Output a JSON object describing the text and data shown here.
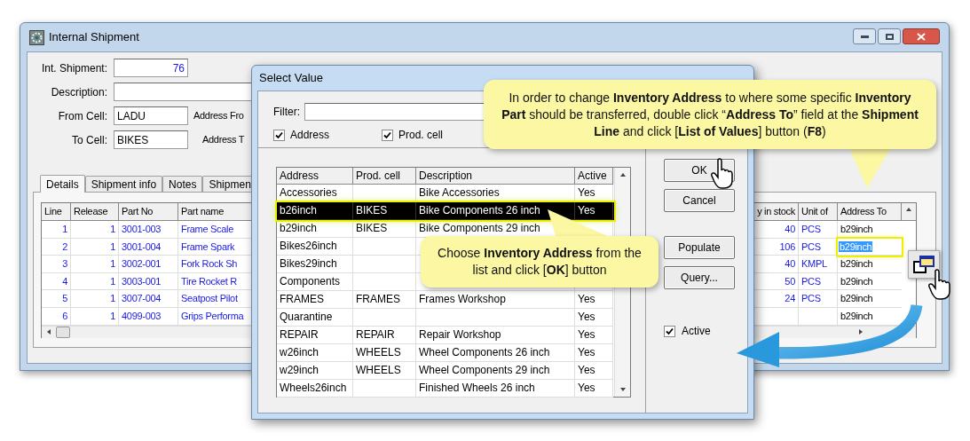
{
  "window": {
    "title": "Internal Shipment"
  },
  "form": {
    "fields": [
      {
        "label": "Int. Shipment:",
        "value": "76"
      },
      {
        "label": "Description:"
      },
      {
        "label": "From Cell:",
        "value": "LADU",
        "side_label": "Address Fro"
      },
      {
        "label": "To Cell:",
        "value": "BIKES",
        "side_label": "Address T"
      }
    ]
  },
  "tabs": [
    {
      "label": "Details",
      "selected": true
    },
    {
      "label": "Shipment info",
      "selected": false
    },
    {
      "label": "Notes",
      "selected": false
    },
    {
      "label": "Shipmen",
      "selected": false
    }
  ],
  "lines_table": {
    "columns": [
      "Line",
      "Release",
      "Part No",
      "Part name",
      "y in stock",
      "Unit of",
      "Address To"
    ],
    "rows": [
      {
        "line": "1",
        "release": "1",
        "part_no": "3001-003",
        "part_name": "Frame Scale",
        "qty": "40",
        "unit": "PCS",
        "address_to": "b29inch",
        "selected": false
      },
      {
        "line": "2",
        "release": "1",
        "part_no": "3001-004",
        "part_name": "Frame Spark",
        "qty": "106",
        "unit": "PCS",
        "address_to": "b29inch",
        "selected": true
      },
      {
        "line": "3",
        "release": "1",
        "part_no": "3002-001",
        "part_name": "Fork Rock Sh",
        "qty": "40",
        "unit": "KMPL",
        "address_to": "b29inch",
        "selected": false
      },
      {
        "line": "4",
        "release": "1",
        "part_no": "3003-001",
        "part_name": "Tire Rocket R",
        "qty": "50",
        "unit": "PCS",
        "address_to": "b29inch",
        "selected": false
      },
      {
        "line": "5",
        "release": "1",
        "part_no": "3007-004",
        "part_name": "Seatpost Pilot",
        "qty": "24",
        "unit": "PCS",
        "address_to": "b29inch",
        "selected": false
      },
      {
        "line": "6",
        "release": "1",
        "part_no": "4099-003",
        "part_name": "Grips Performa",
        "address_to": "b29inch",
        "selected": false
      }
    ]
  },
  "dialog": {
    "title": "Select Value",
    "filter_label": "Filter:",
    "checkboxes": [
      {
        "label": "Address",
        "checked": true
      },
      {
        "label": "Prod. cell",
        "checked": true
      }
    ],
    "table": {
      "columns": [
        "Address",
        "Prod. cell",
        "Description",
        "Active"
      ],
      "rows": [
        {
          "address": "Accessories",
          "description": "Bike Accessories",
          "active": "Yes",
          "selected": false
        },
        {
          "address": "b26inch",
          "prod_cell": "BIKES",
          "description": "Bike Components 26 inch",
          "active": "Yes",
          "selected": true
        },
        {
          "address": "b29inch",
          "prod_cell": "BIKES",
          "description": "Bike Components 29 inch",
          "selected": false
        },
        {
          "address": "Bikes26inch",
          "selected": false
        },
        {
          "address": "Bikes29inch",
          "selected": false
        },
        {
          "address": "Components",
          "selected": false
        },
        {
          "address": "FRAMES",
          "prod_cell": "FRAMES",
          "description": "Frames Workshop",
          "active": "Yes",
          "selected": false
        },
        {
          "address": "Quarantine",
          "active": "Yes",
          "selected": false
        },
        {
          "address": "REPAIR",
          "prod_cell": "REPAIR",
          "description": "Repair Workshop",
          "active": "Yes",
          "selected": false
        },
        {
          "address": "w26inch",
          "prod_cell": "WHEELS",
          "description": "Wheel Components 26 inch",
          "active": "Yes",
          "selected": false
        },
        {
          "address": "w29inch",
          "prod_cell": "WHEELS",
          "description": "Wheel Components 29 inch",
          "active": "Yes",
          "selected": false
        },
        {
          "address": "Wheels26inch",
          "description": "Finished Wheels 26 inch",
          "active": "Yes",
          "selected": false
        }
      ]
    },
    "buttons": [
      "OK",
      "Cancel",
      "Populate",
      "Query..."
    ],
    "active_checkbox": {
      "label": "Active",
      "checked": true
    }
  },
  "callouts": [
    {
      "text": "In order to change **Inventory Address** to where some specific **Inventory Part** should be transferred, double click “**Address To**” field at the **Shipment Line** and click [**List of Values**] button (**F8**)"
    },
    {
      "text": "Choose **Inventory Address** from the list and click [**OK**] button"
    }
  ]
}
